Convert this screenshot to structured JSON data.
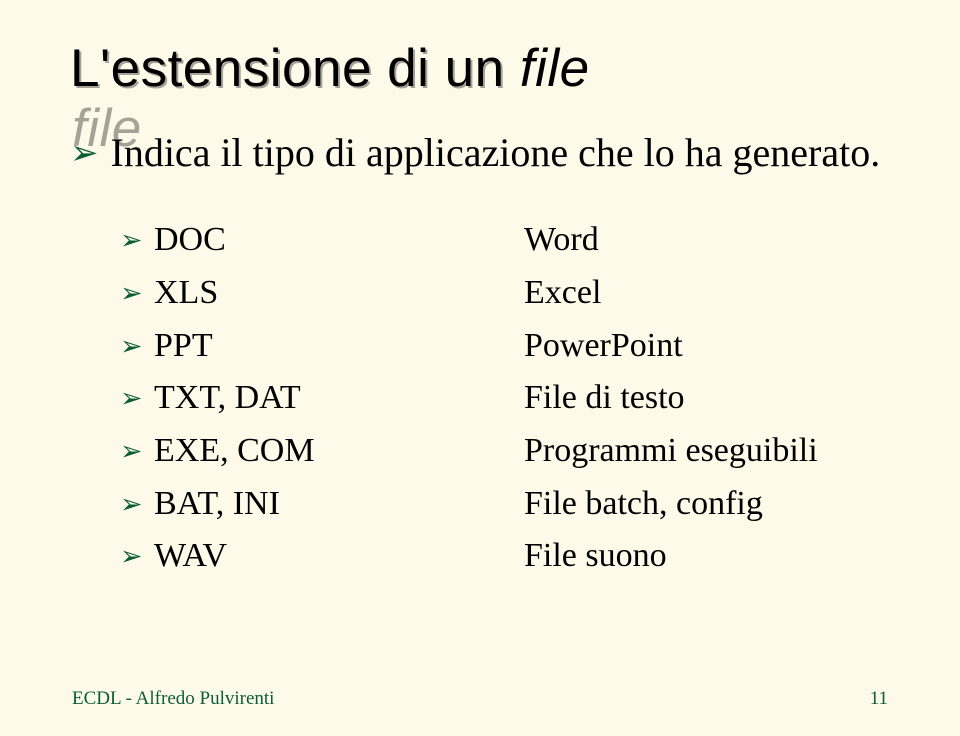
{
  "title": {
    "main": "L'estensione di un ",
    "italic": "file"
  },
  "topPoint": "Indica il tipo di applicazione che lo ha generato.",
  "rows": [
    {
      "ext": "DOC",
      "desc": "Word"
    },
    {
      "ext": "XLS",
      "desc": "Excel"
    },
    {
      "ext": "PPT",
      "desc": "PowerPoint"
    },
    {
      "ext": "TXT, DAT",
      "desc": "File di testo"
    },
    {
      "ext": "EXE, COM",
      "desc": "Programmi eseguibili"
    },
    {
      "ext": "BAT, INI",
      "desc": "File batch, config"
    },
    {
      "ext": "WAV",
      "desc": "File suono"
    }
  ],
  "footer": "ECDL - Alfredo Pulvirenti",
  "pageNumber": "11",
  "bullets": {
    "arrow": "➢"
  }
}
